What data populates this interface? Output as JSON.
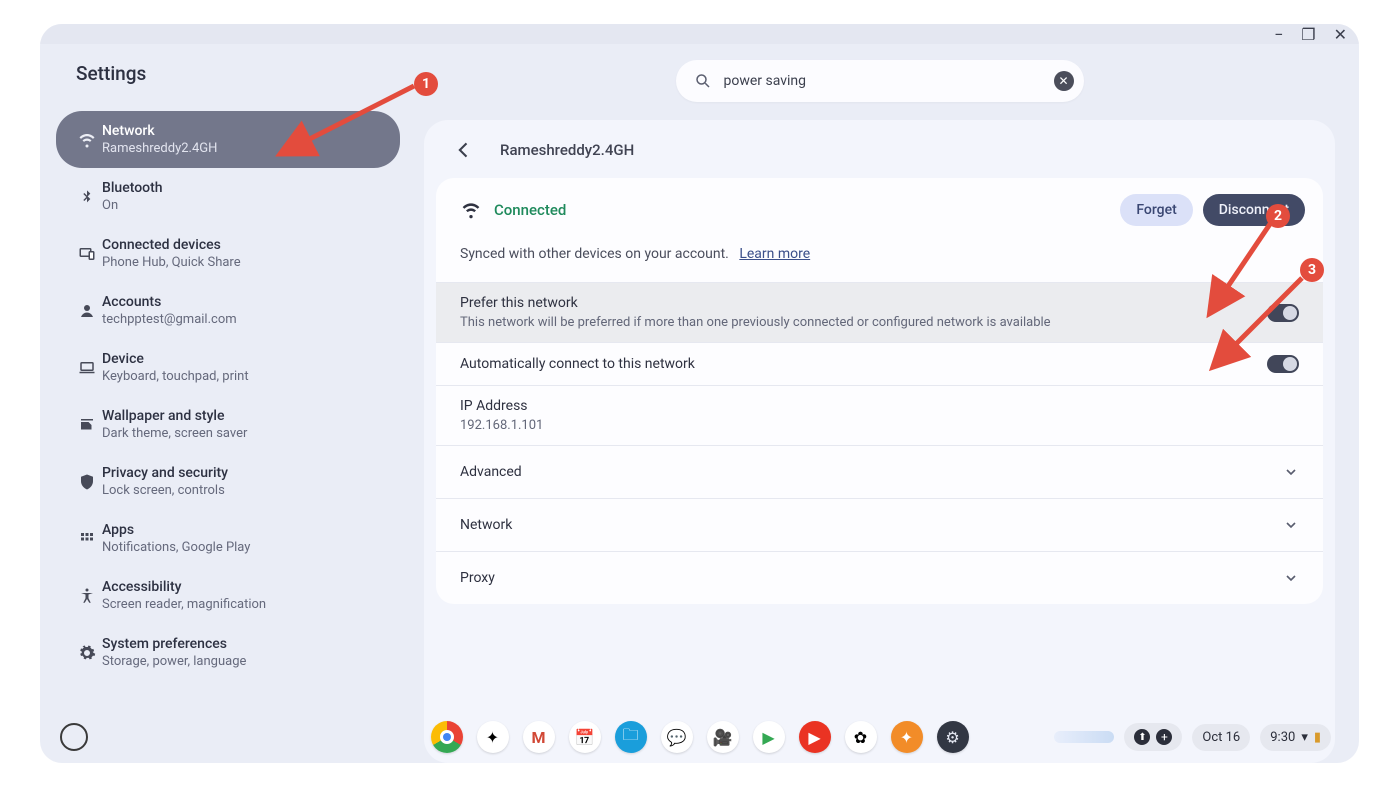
{
  "app_title": "Settings",
  "search": {
    "value": "power saving"
  },
  "window_controls": {
    "min": "−",
    "max": "❐",
    "close": "✕"
  },
  "sidebar": {
    "items": [
      {
        "label": "Network",
        "sub": "Rameshreddy2.4GH",
        "icon": "wifi"
      },
      {
        "label": "Bluetooth",
        "sub": "On",
        "icon": "bt"
      },
      {
        "label": "Connected devices",
        "sub": "Phone Hub, Quick Share",
        "icon": "devices"
      },
      {
        "label": "Accounts",
        "sub": "techpptest@gmail.com",
        "icon": "account"
      },
      {
        "label": "Device",
        "sub": "Keyboard, touchpad, print",
        "icon": "laptop"
      },
      {
        "label": "Wallpaper and style",
        "sub": "Dark theme, screen saver",
        "icon": "style"
      },
      {
        "label": "Privacy and security",
        "sub": "Lock screen, controls",
        "icon": "shield"
      },
      {
        "label": "Apps",
        "sub": "Notifications, Google Play",
        "icon": "apps"
      },
      {
        "label": "Accessibility",
        "sub": "Screen reader, magnification",
        "icon": "a11y"
      },
      {
        "label": "System preferences",
        "sub": "Storage, power, language",
        "icon": "gear"
      }
    ]
  },
  "page": {
    "title": "Rameshreddy2.4GH",
    "status": "Connected",
    "forget": "Forget",
    "disconnect": "Disconnect",
    "synced": "Synced with other devices on your account.",
    "learn_more": "Learn more",
    "rows": {
      "prefer": {
        "t": "Prefer this network",
        "s": "This network will be preferred if more than one previously connected or configured network is available"
      },
      "auto": {
        "t": "Automatically connect to this network"
      },
      "ip": {
        "t": "IP Address",
        "v": "192.168.1.101"
      }
    },
    "expand": {
      "advanced": "Advanced",
      "network": "Network",
      "proxy": "Proxy"
    }
  },
  "colors": {
    "badge": "#e34c3d"
  },
  "annotations": {
    "b1": "1",
    "b2": "2",
    "b3": "3"
  },
  "shelf": {
    "date": "Oct 16",
    "time": "9:30"
  }
}
